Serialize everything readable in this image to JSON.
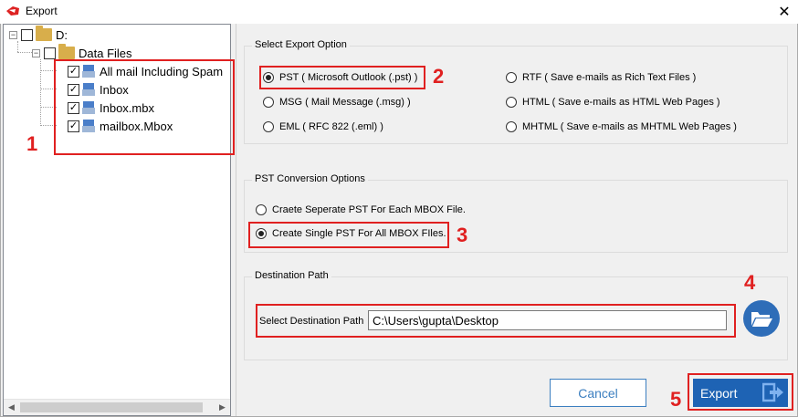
{
  "window": {
    "title": "Export"
  },
  "tree": {
    "root": {
      "label": "D:",
      "checked": false
    },
    "folder": {
      "label": "Data Files",
      "checked": false
    },
    "items": [
      {
        "label": "All mail Including Spam",
        "checked": true
      },
      {
        "label": "Inbox",
        "checked": true
      },
      {
        "label": "Inbox.mbx",
        "checked": true
      },
      {
        "label": "mailbox.Mbox",
        "checked": true
      }
    ]
  },
  "export_option": {
    "title": "Select Export Option",
    "options": [
      {
        "label": "PST ( Microsoft Outlook (.pst) )",
        "selected": true
      },
      {
        "label": "MSG ( Mail Message (.msg) )",
        "selected": false
      },
      {
        "label": "EML ( RFC 822 (.eml) )",
        "selected": false
      },
      {
        "label": "RTF ( Save e-mails as Rich Text Files )",
        "selected": false
      },
      {
        "label": "HTML ( Save e-mails as HTML Web Pages )",
        "selected": false
      },
      {
        "label": "MHTML ( Save e-mails as MHTML Web Pages )",
        "selected": false
      }
    ]
  },
  "pst_options": {
    "title": "PST Conversion Options",
    "options": [
      {
        "label": "Craete Seperate PST  For Each MBOX File.",
        "selected": false
      },
      {
        "label": "Create Single PST For All MBOX FIles.",
        "selected": true
      }
    ]
  },
  "destination": {
    "title": "Destination Path",
    "label": "Select Destination Path",
    "value": "C:\\Users\\gupta\\Desktop"
  },
  "buttons": {
    "cancel": "Cancel",
    "export": "Export"
  },
  "annotations": [
    "1",
    "2",
    "3",
    "4",
    "5"
  ],
  "colors": {
    "annotation": "#e02020",
    "accent": "#1e63b4"
  }
}
